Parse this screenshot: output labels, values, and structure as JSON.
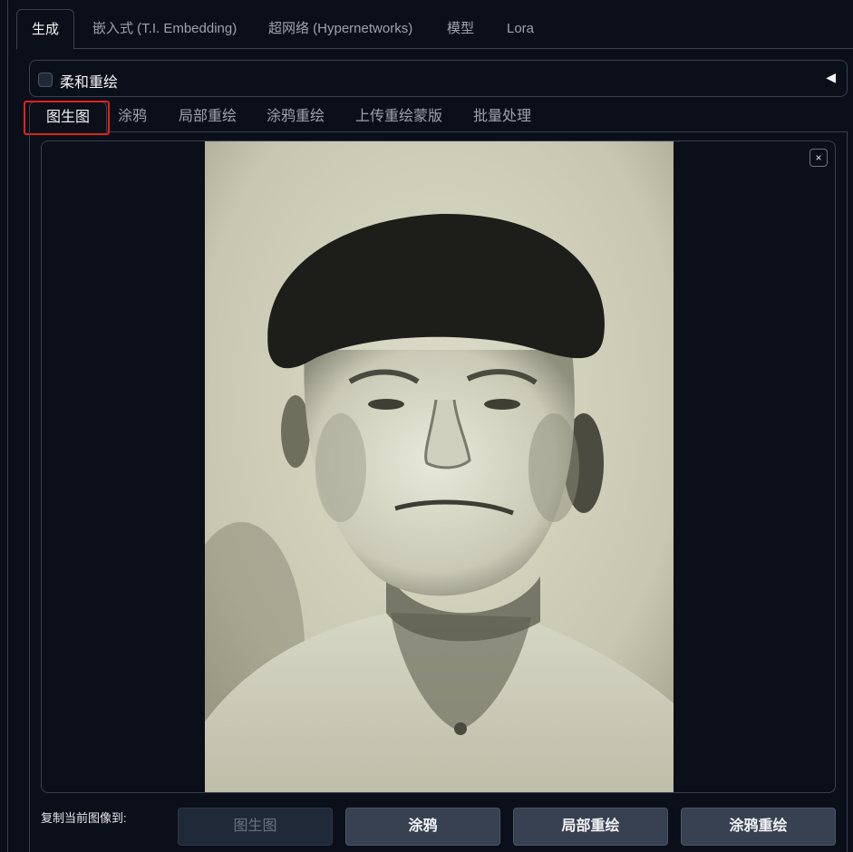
{
  "main_tabs": [
    {
      "label": "生成",
      "active": true
    },
    {
      "label": "嵌入式 (T.I. Embedding)",
      "active": false
    },
    {
      "label": "超网络 (Hypernetworks)",
      "active": false
    },
    {
      "label": "模型",
      "active": false
    },
    {
      "label": "Lora",
      "active": false
    }
  ],
  "accordion": {
    "label": "柔和重绘",
    "checked": false,
    "toggle_icon": "triangle-left-icon"
  },
  "sub_tabs": [
    {
      "label": "图生图",
      "active": true
    },
    {
      "label": "涂鸦",
      "active": false
    },
    {
      "label": "局部重绘",
      "active": false
    },
    {
      "label": "涂鸦重绘",
      "active": false
    },
    {
      "label": "上传重绘蒙版",
      "active": false
    },
    {
      "label": "批量处理",
      "active": false
    }
  ],
  "image_panel": {
    "close_icon": "close-icon",
    "close_label": "×",
    "image_desc_icon": "portrait-photo"
  },
  "copy_to": {
    "label": "复制当前图像到:",
    "buttons": [
      {
        "label": "图生图",
        "disabled": true
      },
      {
        "label": "涂鸦",
        "disabled": false
      },
      {
        "label": "局部重绘",
        "disabled": false
      },
      {
        "label": "涂鸦重绘",
        "disabled": false
      }
    ]
  },
  "colors": {
    "background": "#0b0f19",
    "border": "#374151",
    "highlight": "#e0231b",
    "button": "#374151"
  }
}
